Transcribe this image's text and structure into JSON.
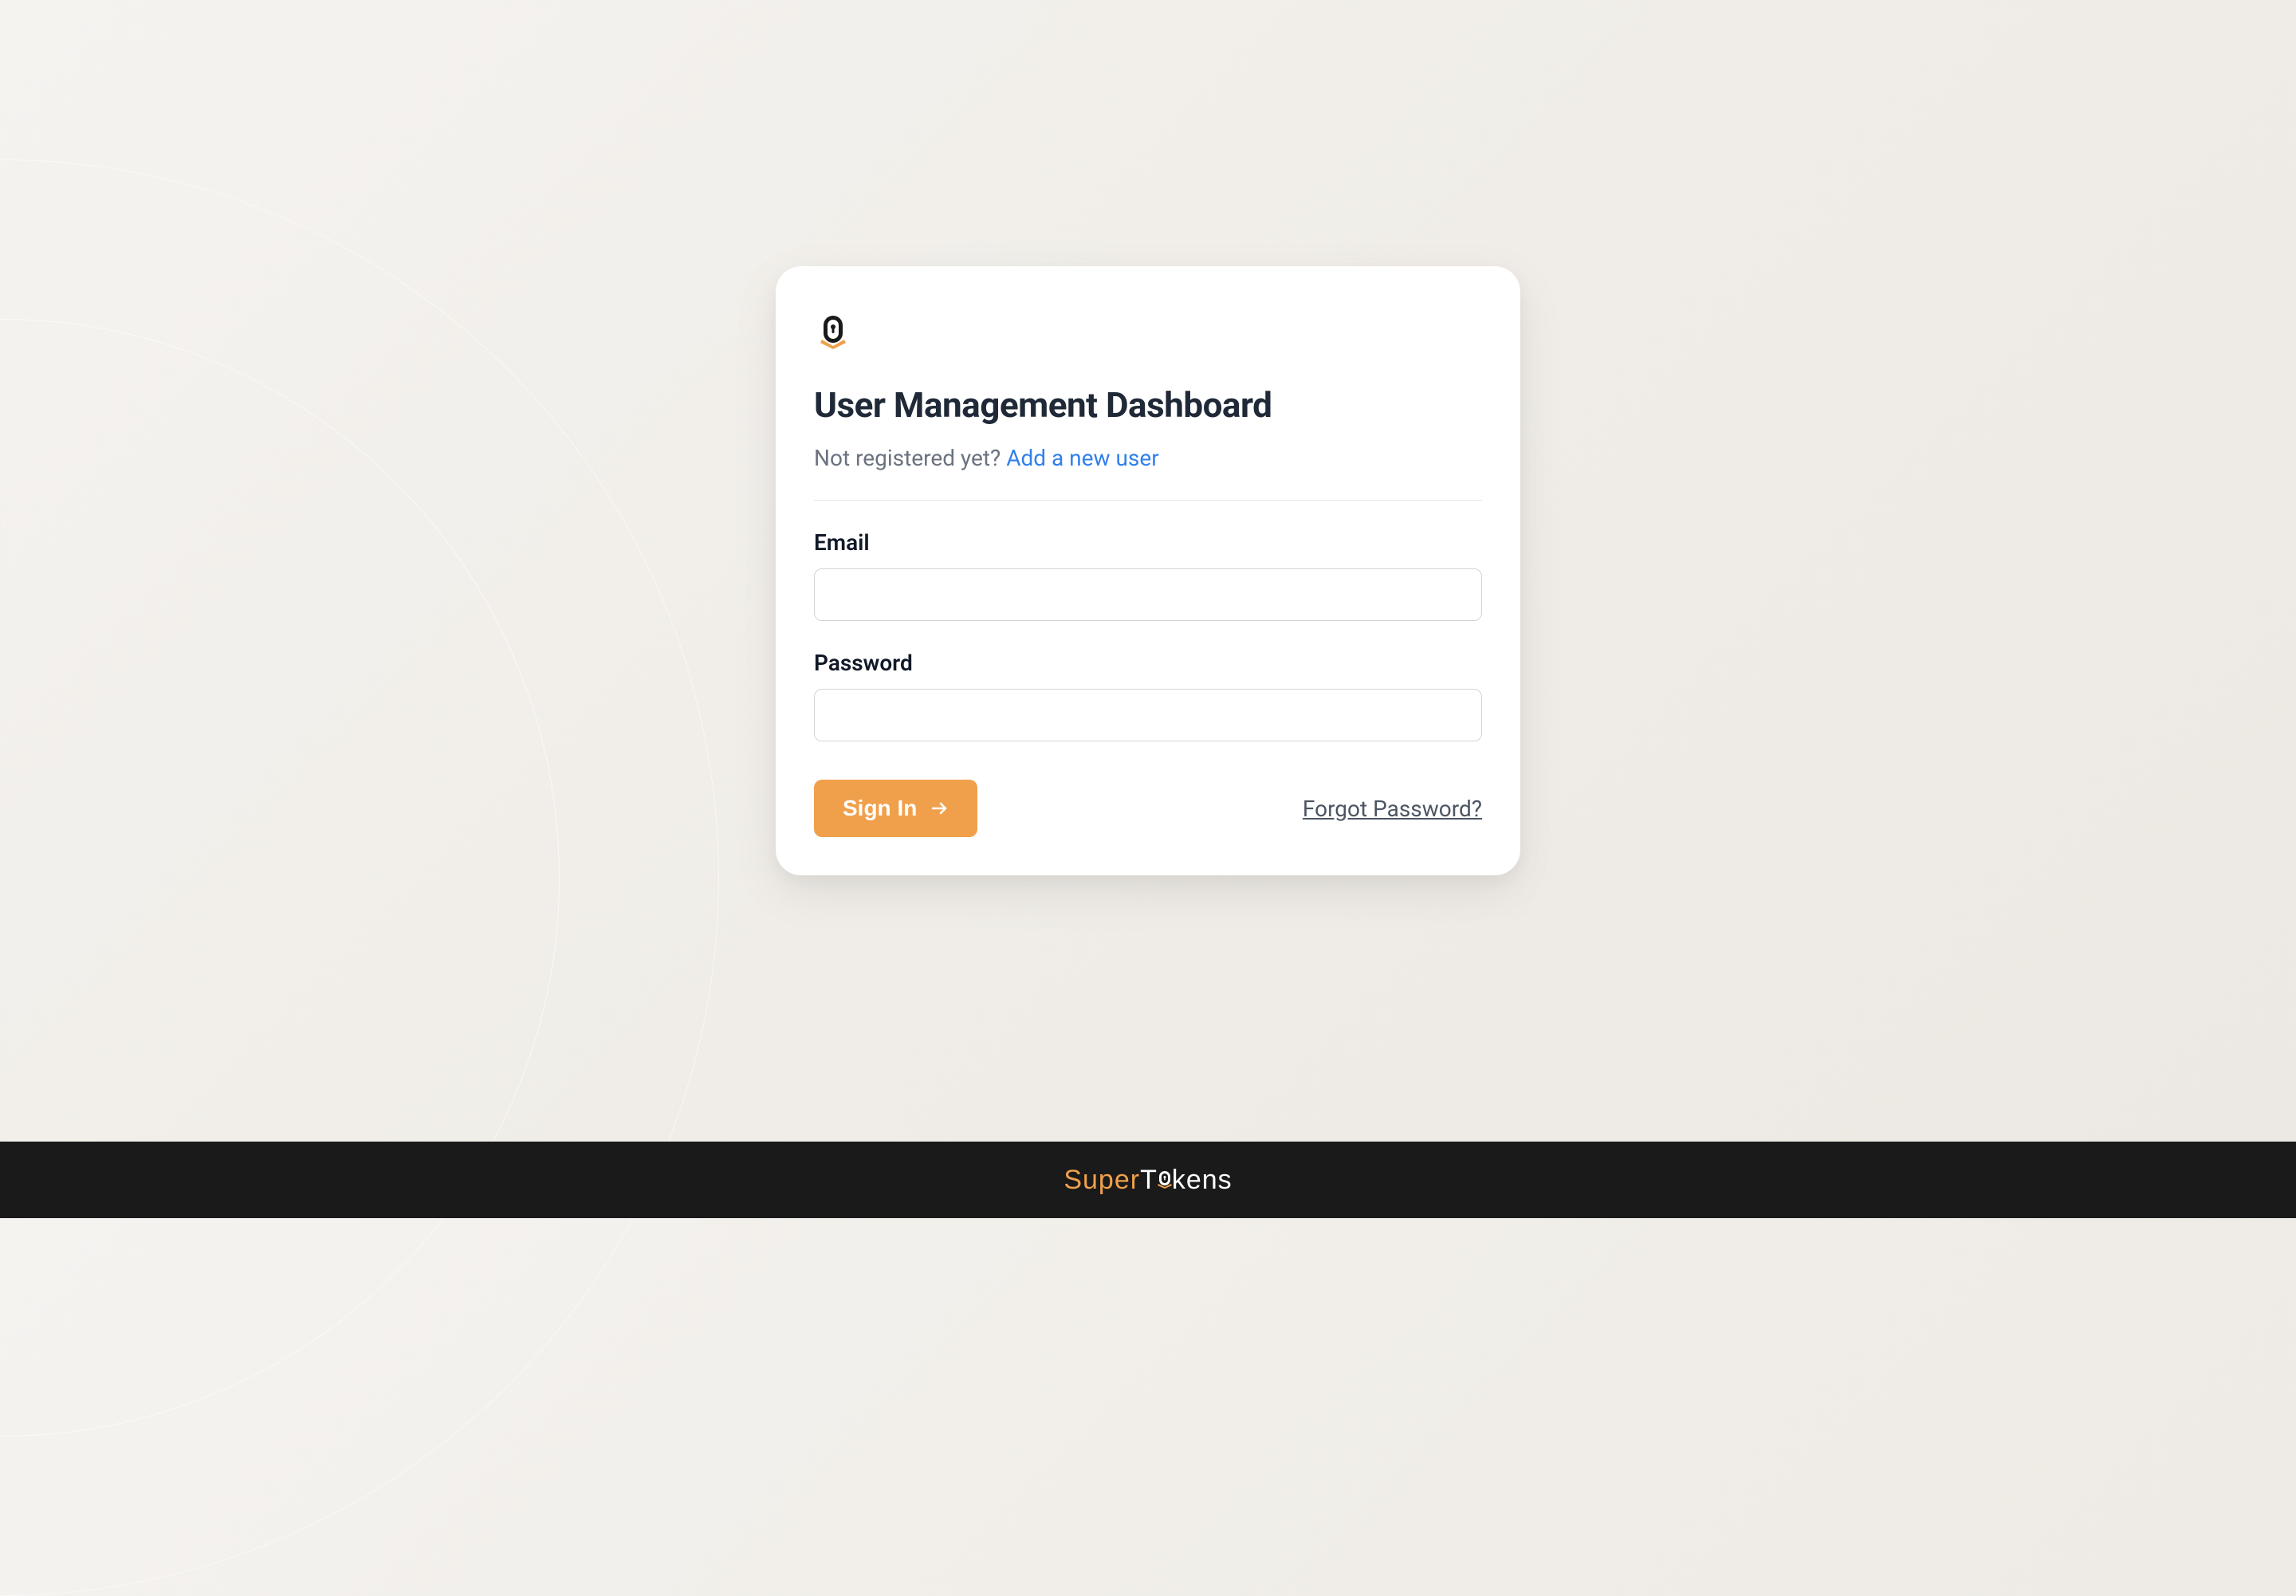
{
  "card": {
    "title": "User Management Dashboard",
    "registerPromptText": "Not registered yet? ",
    "registerLinkText": "Add a new user"
  },
  "form": {
    "emailLabel": "Email",
    "emailValue": "",
    "passwordLabel": "Password",
    "passwordValue": ""
  },
  "actions": {
    "signInLabel": "Sign In",
    "forgotPasswordLabel": "Forgot Password?"
  },
  "footer": {
    "brandPart1": "Super",
    "brandPart2": "T",
    "brandPart3": "kens"
  },
  "colors": {
    "accent": "#f0a04b",
    "link": "#2f80ed",
    "footerBg": "#1a1a1a"
  }
}
